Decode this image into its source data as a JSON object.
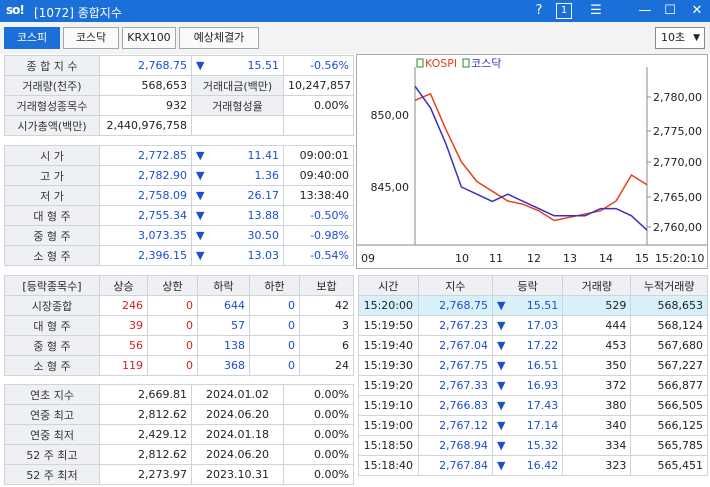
{
  "window": {
    "logo": "so!",
    "title": "[1072] 종합지수",
    "help": "?",
    "one": "1",
    "menu": "☰",
    "minimize": "—",
    "maximize": "☐",
    "close": "✕"
  },
  "toolbar": {
    "tabs": [
      "코스피",
      "코스닥",
      "KRX100",
      "예상체결가"
    ],
    "interval": "10초"
  },
  "summary": {
    "index_label": "종 합 지 수",
    "index_value": "2,768.75",
    "index_arrow": "▼",
    "index_change": "15.51",
    "index_pct": "-0.56%",
    "vol_label": "거래량(천주)",
    "vol_value": "568,653",
    "amt_label": "거래대금(백만)",
    "amt_value": "10,247,857",
    "formed_label": "거래형성종목수",
    "formed_value": "932",
    "formed_rate_label": "거래형성율",
    "formed_rate_value": "0.00%",
    "cap_label": "시가총액(백만)",
    "cap_value": "2,440,976,758"
  },
  "prices": [
    {
      "label": "시 가",
      "value": "2,772.85",
      "arrow": "▼",
      "change": "11.41",
      "time": "09:00:01"
    },
    {
      "label": "고 가",
      "value": "2,782.90",
      "arrow": "▼",
      "change": "1.36",
      "time": "09:40:00"
    },
    {
      "label": "저 가",
      "value": "2,758.09",
      "arrow": "▼",
      "change": "26.17",
      "time": "13:38:40"
    },
    {
      "label": "대 형 주",
      "value": "2,755.34",
      "arrow": "▼",
      "change": "13.88",
      "time": "-0.50%"
    },
    {
      "label": "중 형 주",
      "value": "3,073.35",
      "arrow": "▼",
      "change": "30.50",
      "time": "-0.98%"
    },
    {
      "label": "소 형 주",
      "value": "2,396.15",
      "arrow": "▼",
      "change": "13.03",
      "time": "-0.54%"
    }
  ],
  "breadth": {
    "headers": [
      "[등락종목수]",
      "상승",
      "상한",
      "하락",
      "하한",
      "보합"
    ],
    "rows": [
      {
        "label": "시장종합",
        "up": "246",
        "uplim": "0",
        "down": "644",
        "downlim": "0",
        "flat": "42"
      },
      {
        "label": "대 형 주",
        "up": "39",
        "uplim": "0",
        "down": "57",
        "downlim": "0",
        "flat": "3"
      },
      {
        "label": "중 형 주",
        "up": "56",
        "uplim": "0",
        "down": "138",
        "downlim": "0",
        "flat": "6"
      },
      {
        "label": "소 형 주",
        "up": "119",
        "uplim": "0",
        "down": "368",
        "downlim": "0",
        "flat": "24"
      }
    ]
  },
  "yearly": [
    {
      "label": "연초 지수",
      "value": "2,669.81",
      "date": "2024.01.02",
      "pct": "0.00%"
    },
    {
      "label": "연중 최고",
      "value": "2,812.62",
      "date": "2024.06.20",
      "pct": "0.00%"
    },
    {
      "label": "연중 최저",
      "value": "2,429.12",
      "date": "2024.01.18",
      "pct": "0.00%"
    },
    {
      "label": "52 주 최고",
      "value": "2,812.62",
      "date": "2024.06.20",
      "pct": "0.00%"
    },
    {
      "label": "52 주 최저",
      "value": "2,273.97",
      "date": "2023.10.31",
      "pct": "0.00%"
    }
  ],
  "ticks": {
    "headers": [
      "시간",
      "지수",
      "등락",
      "거래량",
      "누적거래량"
    ],
    "rows": [
      {
        "time": "15:20:00",
        "index": "2,768.75",
        "arrow": "▼",
        "change": "15.51",
        "vol": "529",
        "cum": "568,653"
      },
      {
        "time": "15:19:50",
        "index": "2,767.23",
        "arrow": "▼",
        "change": "17.03",
        "vol": "444",
        "cum": "568,124"
      },
      {
        "time": "15:19:40",
        "index": "2,767.04",
        "arrow": "▼",
        "change": "17.22",
        "vol": "453",
        "cum": "567,680"
      },
      {
        "time": "15:19:30",
        "index": "2,767.75",
        "arrow": "▼",
        "change": "16.51",
        "vol": "350",
        "cum": "567,227"
      },
      {
        "time": "15:19:20",
        "index": "2,767.33",
        "arrow": "▼",
        "change": "16.93",
        "vol": "372",
        "cum": "566,877"
      },
      {
        "time": "15:19:10",
        "index": "2,766.83",
        "arrow": "▼",
        "change": "17.43",
        "vol": "380",
        "cum": "566,505"
      },
      {
        "time": "15:19:00",
        "index": "2,767.12",
        "arrow": "▼",
        "change": "17.14",
        "vol": "340",
        "cum": "566,125"
      },
      {
        "time": "15:18:50",
        "index": "2,768.94",
        "arrow": "▼",
        "change": "15.32",
        "vol": "334",
        "cum": "565,785"
      },
      {
        "time": "15:18:40",
        "index": "2,767.84",
        "arrow": "▼",
        "change": "16.42",
        "vol": "323",
        "cum": "565,451"
      }
    ]
  },
  "chart_data": {
    "type": "line",
    "legend": [
      "KOSPI",
      "코스닥"
    ],
    "left_ticks": [
      "850,00",
      "845,00"
    ],
    "right_ticks": [
      "2,780,00",
      "2,775,00",
      "2,770,00",
      "2,765,00",
      "2,760,00"
    ],
    "x_ticks": [
      "09",
      "10",
      "11",
      "12",
      "13",
      "14",
      "15",
      "15:20:10"
    ],
    "series": [
      {
        "name": "KOSPI",
        "color": "#e8401a",
        "values": [
          2779.5,
          2780.5,
          2775.0,
          2770.0,
          2767.0,
          2765.5,
          2764.0,
          2763.5,
          2762.5,
          2761.0,
          2761.5,
          2762.0,
          2762.5,
          2764.0,
          2768.0,
          2766.5
        ]
      },
      {
        "name": "코스닥",
        "color": "#3a2fc0",
        "values": [
          852.0,
          850.5,
          848.0,
          845.0,
          844.5,
          844.0,
          844.5,
          844.0,
          843.5,
          843.0,
          843.0,
          843.0,
          843.5,
          843.5,
          843.0,
          842.0
        ]
      }
    ]
  }
}
